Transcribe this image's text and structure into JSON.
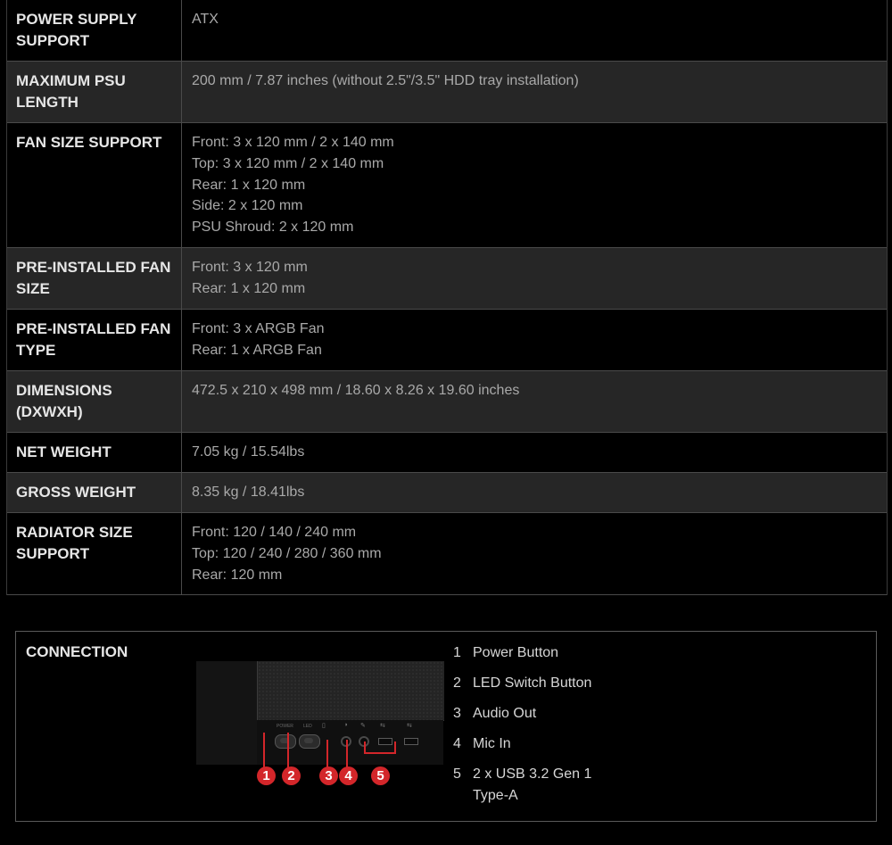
{
  "specs": [
    {
      "label": "POWER SUPPLY SUPPORT",
      "lines": [
        "ATX"
      ]
    },
    {
      "label": "MAXIMUM PSU LENGTH",
      "lines": [
        "200 mm / 7.87 inches (without 2.5\"/3.5\" HDD tray installation)"
      ]
    },
    {
      "label": "FAN SIZE SUPPORT",
      "lines": [
        "Front: 3 x 120 mm / 2 x 140 mm",
        "Top: 3 x 120 mm / 2 x 140 mm",
        "Rear: 1 x 120 mm",
        "Side: 2 x 120 mm",
        "PSU Shroud: 2 x 120 mm"
      ]
    },
    {
      "label": "PRE-INSTALLED FAN SIZE",
      "lines": [
        "Front: 3 x 120 mm",
        "Rear: 1 x 120 mm"
      ]
    },
    {
      "label": "PRE-INSTALLED FAN TYPE",
      "lines": [
        "Front: 3 x ARGB Fan",
        "Rear: 1 x ARGB Fan"
      ]
    },
    {
      "label": "DIMENSIONS (DXWXH)",
      "lines": [
        "472.5 x 210 x 498 mm / 18.60 x 8.26 x 19.60 inches"
      ]
    },
    {
      "label": "NET WEIGHT",
      "lines": [
        "7.05 kg / 15.54lbs"
      ]
    },
    {
      "label": "GROSS WEIGHT",
      "lines": [
        "8.35 kg / 18.41lbs"
      ]
    },
    {
      "label": "RADIATOR SIZE SUPPORT",
      "lines": [
        "Front: 120 / 140 / 240 mm",
        "Top: 120 / 240 / 280 / 360 mm",
        "Rear: 120 mm"
      ]
    }
  ],
  "connection": {
    "title": "CONNECTION",
    "image_labels": {
      "power": "POWER",
      "led": "LED"
    },
    "callouts": [
      "1",
      "2",
      "3",
      "4",
      "5"
    ],
    "items": [
      {
        "num": "1",
        "text": "Power Button"
      },
      {
        "num": "2",
        "text": "LED Switch Button"
      },
      {
        "num": "3",
        "text": "Audio Out"
      },
      {
        "num": "4",
        "text": "Mic In"
      },
      {
        "num": "5",
        "text": "2 x USB 3.2 Gen 1 Type-A"
      }
    ]
  },
  "colors": {
    "background": "#000000",
    "row_alt": "#262626",
    "accent_red": "#d3262a"
  }
}
